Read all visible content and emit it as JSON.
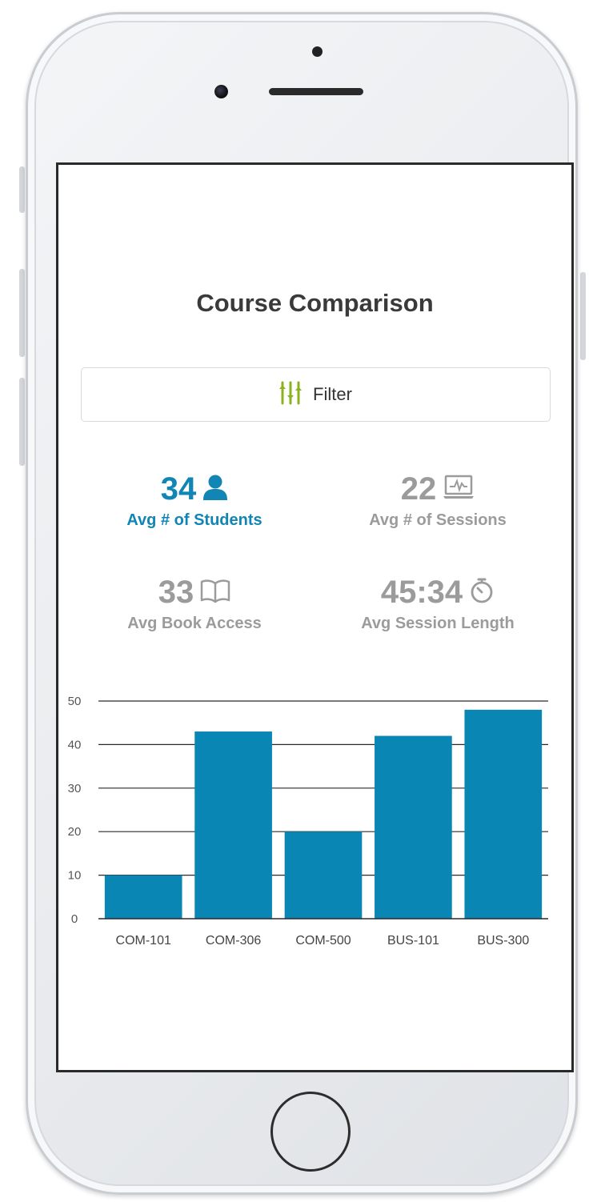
{
  "screen": {
    "title": "Course Comparison",
    "filter": {
      "label": "Filter",
      "icon": "filter-sliders-icon",
      "icon_color": "#8cb21e"
    },
    "stats": [
      {
        "value": "34",
        "label": "Avg # of Students",
        "icon": "user-icon",
        "color": "#1185b4"
      },
      {
        "value": "22",
        "label": "Avg # of Sessions",
        "icon": "monitor-activity-icon",
        "color": "#9b9b9b"
      },
      {
        "value": "33",
        "label": "Avg Book Access",
        "icon": "open-book-icon",
        "color": "#9b9b9b"
      },
      {
        "value": "45:34",
        "label": "Avg Session Length",
        "icon": "stopwatch-icon",
        "color": "#9b9b9b"
      }
    ]
  },
  "chart_data": {
    "type": "bar",
    "categories": [
      "COM-101",
      "COM-306",
      "COM-500",
      "BUS-101",
      "BUS-300"
    ],
    "values": [
      10,
      43,
      20,
      42,
      48
    ],
    "ylim": [
      0,
      50
    ],
    "yticks": [
      0,
      10,
      20,
      30,
      40,
      50
    ],
    "grid": true,
    "bar_color": "#0a86b4"
  }
}
